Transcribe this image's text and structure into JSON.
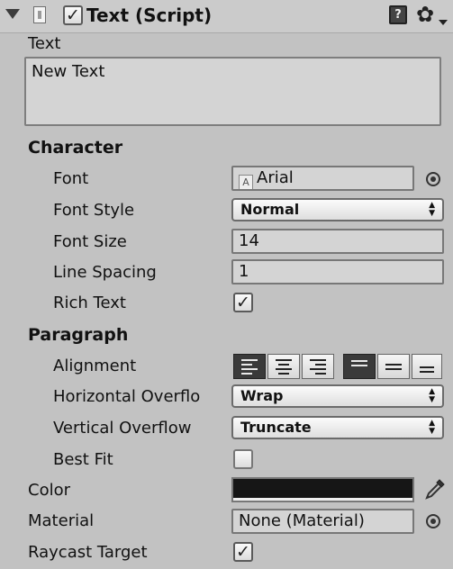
{
  "header": {
    "title": "Text (Script)",
    "enabled": true,
    "icons": [
      "fold-arrow-icon",
      "script-icon",
      "help-book-icon",
      "gear-icon"
    ]
  },
  "text": {
    "label": "Text",
    "value": "New Text"
  },
  "character": {
    "heading": "Character",
    "font_label": "Font",
    "font_value": "Arial",
    "font_style_label": "Font Style",
    "font_style_value": "Normal",
    "font_size_label": "Font Size",
    "font_size_value": "14",
    "line_spacing_label": "Line Spacing",
    "line_spacing_value": "1",
    "rich_text_label": "Rich Text",
    "rich_text_checked": true
  },
  "paragraph": {
    "heading": "Paragraph",
    "alignment_label": "Alignment",
    "horizontal_alignment": [
      "left",
      "center",
      "right"
    ],
    "horizontal_selected": "left",
    "vertical_alignment": [
      "top",
      "middle",
      "bottom"
    ],
    "vertical_selected": "top",
    "horizontal_overflow_label": "Horizontal Overflo",
    "horizontal_overflow_value": "Wrap",
    "vertical_overflow_label": "Vertical Overflow",
    "vertical_overflow_value": "Truncate",
    "best_fit_label": "Best Fit",
    "best_fit_checked": false
  },
  "color": {
    "label": "Color",
    "value": "#161616"
  },
  "material": {
    "label": "Material",
    "value": "None (Material)"
  },
  "raycast": {
    "label": "Raycast Target",
    "checked": true
  },
  "glyphs": {
    "check": "✓",
    "gear": "✿",
    "book": "?",
    "dropdown_arrows": "▲▼"
  }
}
